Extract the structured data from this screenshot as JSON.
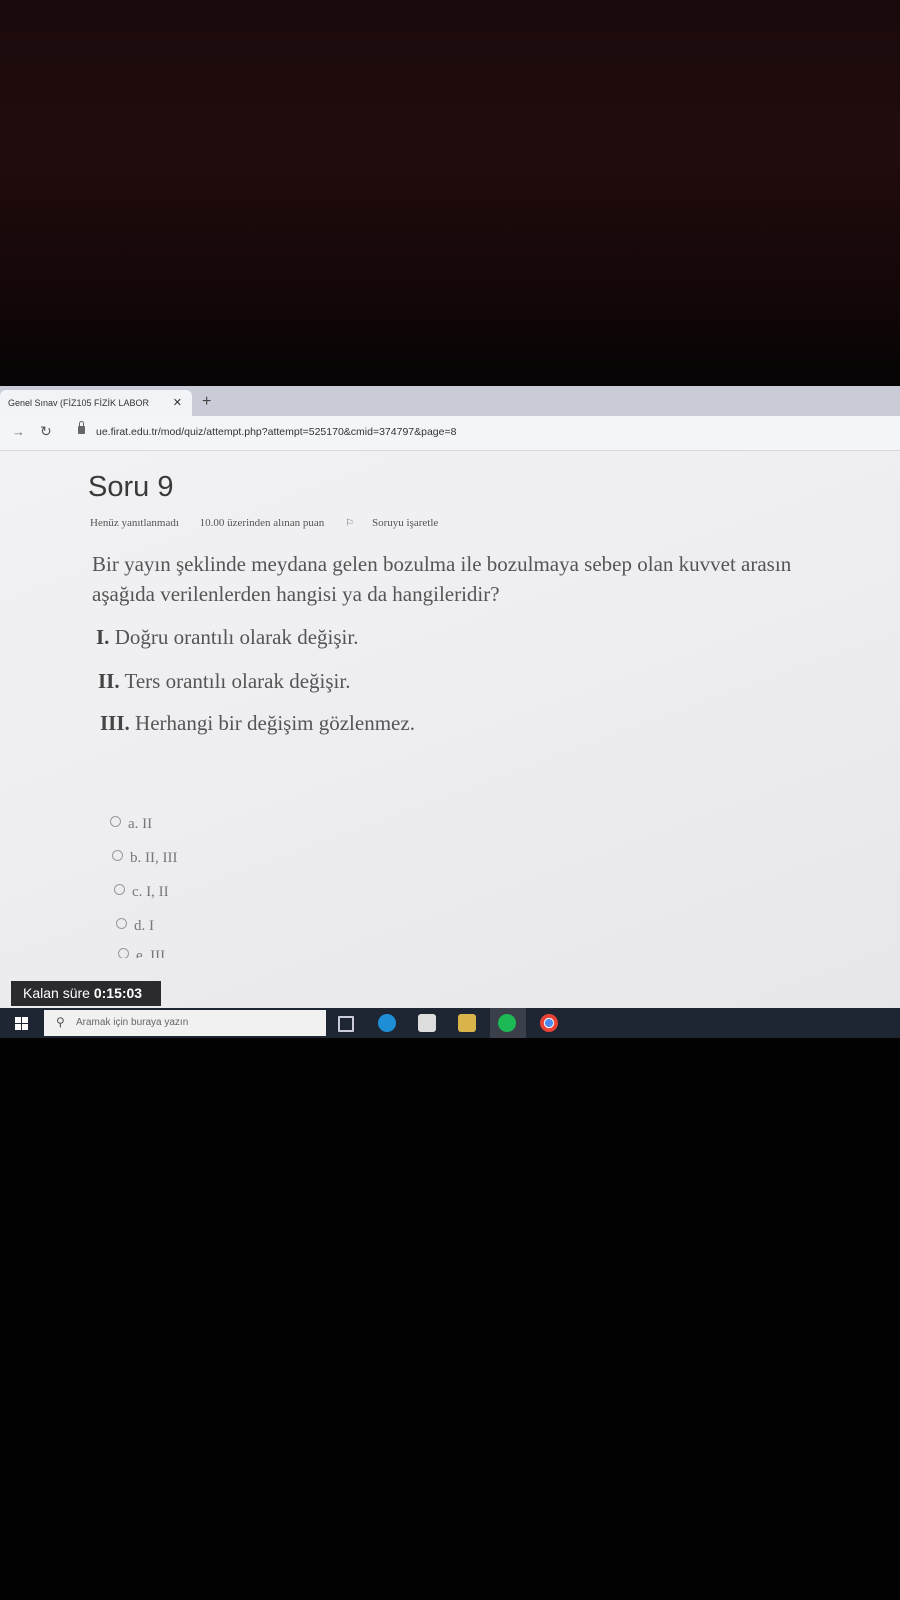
{
  "browser": {
    "tab_title": "Genel Sınav (FİZ105 FİZİK LABOR",
    "tab_close": "✕",
    "new_tab": "+",
    "url": "ue.firat.edu.tr/mod/quiz/attempt.php?attempt=525170&cmid=374797&page=8"
  },
  "question": {
    "title": "Soru 9",
    "status": "Henüz yanıtlanmadı",
    "points": "10.00 üzerinden alınan puan",
    "flag_label": "Soruyu işaretle",
    "text_line1": "Bir yayın şeklinde meydana gelen bozulma ile bozulmaya sebep olan kuvvet arasın",
    "text_line2": "aşağıda verilenlerden hangisi ya da hangileridir?",
    "statements": [
      {
        "num": "I.",
        "text": "Doğru orantılı olarak değişir."
      },
      {
        "num": "II.",
        "text": "Ters orantılı olarak değişir."
      },
      {
        "num": "III.",
        "text": "Herhangi bir değişim gözlenmez."
      }
    ],
    "options": [
      "a. II",
      "b. II, III",
      "c. I, II",
      "d. I",
      "e. III"
    ]
  },
  "timer": {
    "label": "Kalan süre",
    "value": "0:15:03"
  },
  "taskbar": {
    "search_placeholder": "Aramak için buraya yazın"
  }
}
